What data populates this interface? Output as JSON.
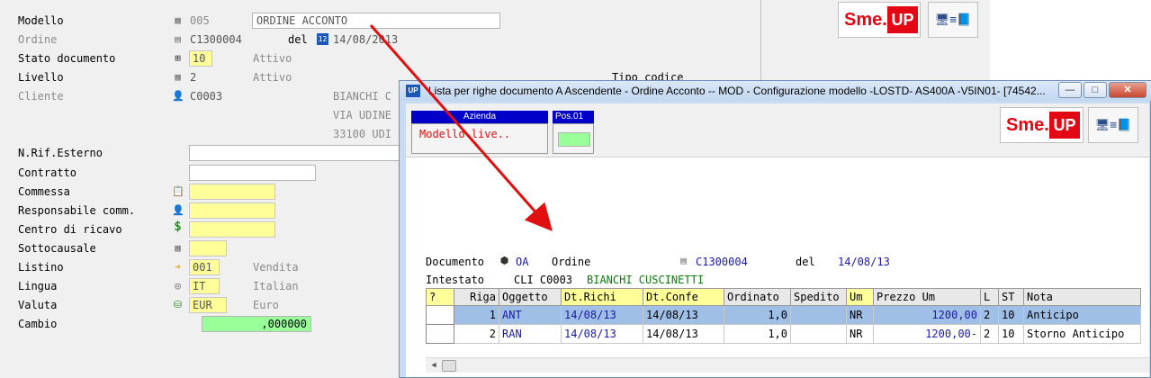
{
  "background_form": {
    "rows": [
      {
        "label": "Modello",
        "code": "005",
        "desc": "ORDINE ACCONTO"
      },
      {
        "label": "Ordine",
        "code": "C1300004",
        "del_label": "del",
        "date": "14/08/2013"
      },
      {
        "label": "Stato documento",
        "code": "10",
        "desc": "Attivo"
      },
      {
        "label": "Livello",
        "code": "2",
        "desc": "Attivo"
      },
      {
        "label": "Cliente",
        "code": "C0003",
        "addr1": "BIANCHI C",
        "addr2": "VIA UDINE",
        "addr3": "33100 UDI"
      },
      {
        "label": "N.Rif.Esterno"
      },
      {
        "label": "Contratto"
      },
      {
        "label": "Commessa"
      },
      {
        "label": "Responsabile comm."
      },
      {
        "label": "Centro di ricavo"
      },
      {
        "label": "Sottocausale"
      },
      {
        "label": "Listino",
        "code": "001",
        "desc": "Vendita"
      },
      {
        "label": "Lingua",
        "code": "IT",
        "desc": "Italian"
      },
      {
        "label": "Valuta",
        "code": "EUR",
        "desc": "Euro"
      },
      {
        "label": "Cambio",
        "value": ",000000"
      }
    ],
    "tipo_codice": "Tipo codice"
  },
  "brand": {
    "sme": "Sme.",
    "up": "UP"
  },
  "window": {
    "app_icon": "UP",
    "title": "Lista per righe documento A Ascendente -  Ordine Acconto -- MOD - Configurazione modello -LOSTD- AS400A -V5IN01- [74542...",
    "btn_min": "—",
    "btn_max": "□",
    "btn_close": "✕"
  },
  "header": {
    "azienda_label": "Azienda",
    "azienda_value": "Modello live..",
    "pos_label": "Pos.01"
  },
  "document": {
    "doc_label": "Documento",
    "doc_code": "OA",
    "doc_type": "Ordine",
    "doc_number": "C1300004",
    "del_label": "del",
    "doc_date": "14/08/13",
    "intestato_label": "Intestato",
    "cli_prefix": "CLI C0003",
    "cli_name": "BIANCHI CUSCINETTI"
  },
  "table": {
    "columns": [
      "?",
      "Riga",
      "Oggetto",
      "Dt.Richi",
      "Dt.Confe",
      "Ordinato",
      "Spedito",
      "Um",
      "Prezzo Um",
      "L",
      "ST",
      "Nota"
    ],
    "rows": [
      {
        "riga": "1",
        "oggetto": "ANT",
        "dt_richi": "14/08/13",
        "dt_confe": "14/08/13",
        "ordinato": "1,0",
        "spedito": "",
        "um": "NR",
        "prezzo": "1200,00",
        "l": "2",
        "st": "10",
        "nota": "Anticipo"
      },
      {
        "riga": "2",
        "oggetto": "RAN",
        "dt_richi": "14/08/13",
        "dt_confe": "14/08/13",
        "ordinato": "1,0",
        "spedito": "",
        "um": "NR",
        "prezzo": "1200,00-",
        "l": "2",
        "st": "10",
        "nota": "Storno Anticipo"
      }
    ]
  },
  "colors": {
    "annotation_arrow": "#e01010",
    "selected_row": "#9fbfe6",
    "yellow_field": "#ffff99",
    "green_field": "#99ff99",
    "brand_red": "#e30613"
  },
  "icons": {
    "model": "grid-icon",
    "calendar": "calendar-icon",
    "hierarchy": "hierarchy-icon",
    "user": "user-icon",
    "money": "dollar-icon",
    "arrow": "arrow-right-icon",
    "language": "globe-icon",
    "currency": "coins-icon"
  }
}
